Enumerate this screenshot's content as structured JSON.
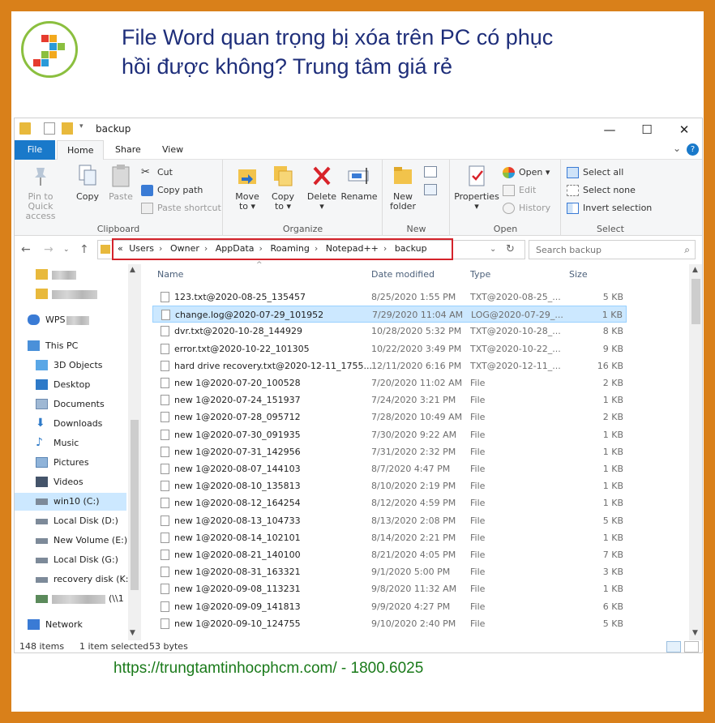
{
  "banner": {
    "title_line1": "File Word quan trọng bị xóa trên PC có phục",
    "title_line2": "hồi được không? Trung tâm giá rẻ",
    "footer": "https://trungtamtinhocphcm.com/ - 1800.6025"
  },
  "window": {
    "title": "backup",
    "controls": {
      "minimize": "—",
      "maximize": "☐",
      "close": "✕"
    }
  },
  "menu": {
    "file": "File",
    "home": "Home",
    "share": "Share",
    "view": "View",
    "help": "?"
  },
  "ribbon": {
    "clipboard": {
      "label": "Clipboard",
      "pin": "Pin to Quick access",
      "copy": "Copy",
      "paste": "Paste",
      "cut": "Cut",
      "copy_path": "Copy path",
      "paste_shortcut": "Paste shortcut"
    },
    "organize": {
      "label": "Organize",
      "move_to": "Move to ▾",
      "copy_to": "Copy to ▾",
      "delete": "Delete ▾",
      "rename": "Rename"
    },
    "new": {
      "label": "New",
      "new_folder": "New folder"
    },
    "open": {
      "label": "Open",
      "properties": "Properties ▾",
      "open": "Open ▾",
      "edit": "Edit",
      "history": "History"
    },
    "select": {
      "label": "Select",
      "select_all": "Select all",
      "select_none": "Select none",
      "invert": "Invert selection"
    }
  },
  "address": {
    "crumbs": [
      "«",
      "Users",
      "Owner",
      "AppData",
      "Roaming",
      "Notepad++",
      "backup"
    ],
    "search_placeholder": "Search backup"
  },
  "nav": {
    "items": [
      {
        "label": "WPS",
        "icon": "cloud-icon"
      },
      {
        "label": "This PC",
        "icon": "computer-icon"
      },
      {
        "label": "3D Objects",
        "icon": "cube-icon"
      },
      {
        "label": "Desktop",
        "icon": "desktop-icon"
      },
      {
        "label": "Documents",
        "icon": "documents-icon"
      },
      {
        "label": "Downloads",
        "icon": "download-icon"
      },
      {
        "label": "Music",
        "icon": "music-icon"
      },
      {
        "label": "Pictures",
        "icon": "pictures-icon"
      },
      {
        "label": "Videos",
        "icon": "videos-icon"
      },
      {
        "label": "win10 (C:)",
        "icon": "drive-icon"
      },
      {
        "label": "Local Disk (D:)",
        "icon": "drive-icon"
      },
      {
        "label": "New Volume (E:)",
        "icon": "drive-icon"
      },
      {
        "label": "Local Disk (G:)",
        "icon": "drive-icon"
      },
      {
        "label": "recovery disk (K:)",
        "icon": "drive-icon"
      },
      {
        "label": "(\\\\1",
        "icon": "network-drive-icon"
      },
      {
        "label": "Network",
        "icon": "network-icon"
      }
    ]
  },
  "columns": {
    "name": "Name",
    "date": "Date modified",
    "type": "Type",
    "size": "Size"
  },
  "files": [
    {
      "name": "123.txt@2020-08-25_135457",
      "date": "8/25/2020 1:55 PM",
      "type": "TXT@2020-08-25_...",
      "size": "5 KB"
    },
    {
      "name": "change.log@2020-07-29_101952",
      "date": "7/29/2020 11:04 AM",
      "type": "LOG@2020-07-29_...",
      "size": "1 KB"
    },
    {
      "name": "dvr.txt@2020-10-28_144929",
      "date": "10/28/2020 5:32 PM",
      "type": "TXT@2020-10-28_...",
      "size": "8 KB"
    },
    {
      "name": "error.txt@2020-10-22_101305",
      "date": "10/22/2020 3:49 PM",
      "type": "TXT@2020-10-22_...",
      "size": "9 KB"
    },
    {
      "name": "hard drive recovery.txt@2020-12-11_1755...",
      "date": "12/11/2020 6:16 PM",
      "type": "TXT@2020-12-11_...",
      "size": "16 KB"
    },
    {
      "name": "new 1@2020-07-20_100528",
      "date": "7/20/2020 11:02 AM",
      "type": "File",
      "size": "2 KB"
    },
    {
      "name": "new 1@2020-07-24_151937",
      "date": "7/24/2020 3:21 PM",
      "type": "File",
      "size": "1 KB"
    },
    {
      "name": "new 1@2020-07-28_095712",
      "date": "7/28/2020 10:49 AM",
      "type": "File",
      "size": "2 KB"
    },
    {
      "name": "new 1@2020-07-30_091935",
      "date": "7/30/2020 9:22 AM",
      "type": "File",
      "size": "1 KB"
    },
    {
      "name": "new 1@2020-07-31_142956",
      "date": "7/31/2020 2:32 PM",
      "type": "File",
      "size": "1 KB"
    },
    {
      "name": "new 1@2020-08-07_144103",
      "date": "8/7/2020 4:47 PM",
      "type": "File",
      "size": "1 KB"
    },
    {
      "name": "new 1@2020-08-10_135813",
      "date": "8/10/2020 2:19 PM",
      "type": "File",
      "size": "1 KB"
    },
    {
      "name": "new 1@2020-08-12_164254",
      "date": "8/12/2020 4:59 PM",
      "type": "File",
      "size": "1 KB"
    },
    {
      "name": "new 1@2020-08-13_104733",
      "date": "8/13/2020 2:08 PM",
      "type": "File",
      "size": "5 KB"
    },
    {
      "name": "new 1@2020-08-14_102101",
      "date": "8/14/2020 2:21 PM",
      "type": "File",
      "size": "1 KB"
    },
    {
      "name": "new 1@2020-08-21_140100",
      "date": "8/21/2020 4:05 PM",
      "type": "File",
      "size": "7 KB"
    },
    {
      "name": "new 1@2020-08-31_163321",
      "date": "9/1/2020 5:00 PM",
      "type": "File",
      "size": "3 KB"
    },
    {
      "name": "new 1@2020-09-08_113231",
      "date": "9/8/2020 11:32 AM",
      "type": "File",
      "size": "1 KB"
    },
    {
      "name": "new 1@2020-09-09_141813",
      "date": "9/9/2020 4:27 PM",
      "type": "File",
      "size": "6 KB"
    },
    {
      "name": "new 1@2020-09-10_124755",
      "date": "9/10/2020 2:40 PM",
      "type": "File",
      "size": "5 KB"
    }
  ],
  "selected_index": 1,
  "status": {
    "items": "148 items",
    "selected": "1 item selected",
    "size": "53 bytes"
  },
  "colors": {
    "accent": "#1979ca",
    "highlight": "#cce8ff",
    "red_frame": "#d4232b",
    "border": "#d9801a",
    "headline": "#1e2e7a",
    "footer": "#1a7a1a"
  }
}
